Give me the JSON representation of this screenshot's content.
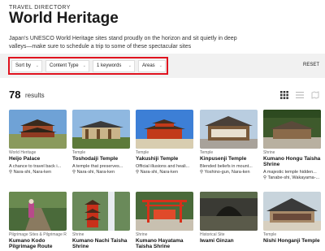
{
  "header": {
    "eyebrow": "TRAVEL DIRECTORY",
    "title": "World Heritage",
    "intro": "Japan's UNESCO World Heritage sites stand proudly on the horizon and sit quietly in deep valleys—make sure to schedule a trip to some of these spectacular sites"
  },
  "filters": {
    "sort": "Sort by",
    "content_type": "Content Type",
    "keywords": "1 keywords",
    "areas": "Areas",
    "reset": "RESET",
    "highlight_color": "#e0131f"
  },
  "results": {
    "count": "78",
    "label": "results"
  },
  "view_icons": [
    "grid-view-icon",
    "list-view-icon",
    "map-view-icon"
  ],
  "cards": [
    {
      "category": "World Heritage",
      "name": "Heijo Palace",
      "desc": "A chance to travel back i...",
      "loc": "Nara-shi, Nara-ken"
    },
    {
      "category": "Temple",
      "name": "Toshodaiji Temple",
      "desc": "A temple that preserves...",
      "loc": "Nara-shi, Nara-ken"
    },
    {
      "category": "Temple",
      "name": "Yakushiji Temple",
      "desc": "Official illusions and heali...",
      "loc": "Nara-shi, Nara-ken"
    },
    {
      "category": "Temple",
      "name": "Kinpusenji Temple",
      "desc": "Blended beliefs in mount...",
      "loc": "Yoshino-gun, Nara-ken"
    },
    {
      "category": "Shrine",
      "name": "Kumano Hongu Taisha Shrine",
      "desc": "A majestic temple hidden...",
      "loc": "Tanabe-shi, Wakayama-..."
    },
    {
      "category": "Pilgrimage Sites & Pilgrimage Routes",
      "name": "Kumano Kodo Pilgrimage Route",
      "desc": "",
      "loc": ""
    },
    {
      "category": "Shrine",
      "name": "Kumano Nachi Taisha Shrine",
      "desc": "",
      "loc": ""
    },
    {
      "category": "Shrine",
      "name": "Kumano Hayatama Taisha Shrine",
      "desc": "",
      "loc": ""
    },
    {
      "category": "Historical Site",
      "name": "Iwami Ginzan",
      "desc": "",
      "loc": ""
    },
    {
      "category": "Temple",
      "name": "Nishi Honganji Temple",
      "desc": "",
      "loc": ""
    }
  ]
}
